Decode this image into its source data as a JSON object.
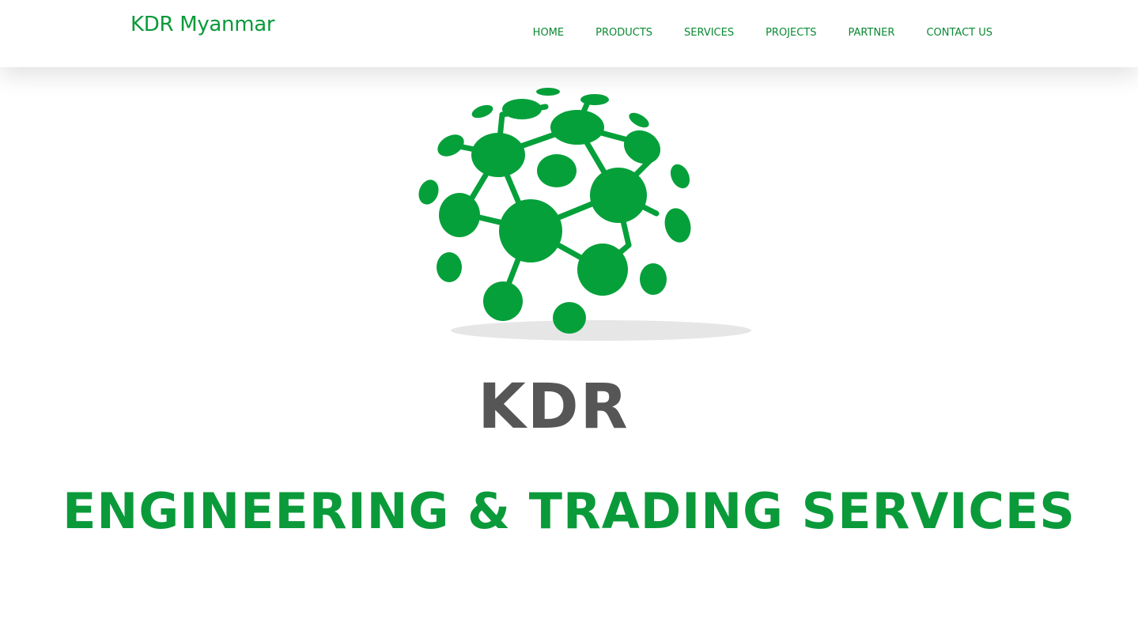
{
  "header": {
    "brand": "KDR Myanmar",
    "nav": [
      {
        "label": "HOME"
      },
      {
        "label": "PRODUCTS"
      },
      {
        "label": "SERVICES"
      },
      {
        "label": "PROJECTS"
      },
      {
        "label": "PARTNER"
      },
      {
        "label": "CONTACT US"
      }
    ]
  },
  "hero": {
    "logo_icon": "molecule-globe-icon",
    "title": "KDR",
    "tagline": "ENGINEERING & TRADING SERVICES"
  },
  "colors": {
    "brand_green": "#0a9a3a",
    "title_gray": "#565656"
  }
}
